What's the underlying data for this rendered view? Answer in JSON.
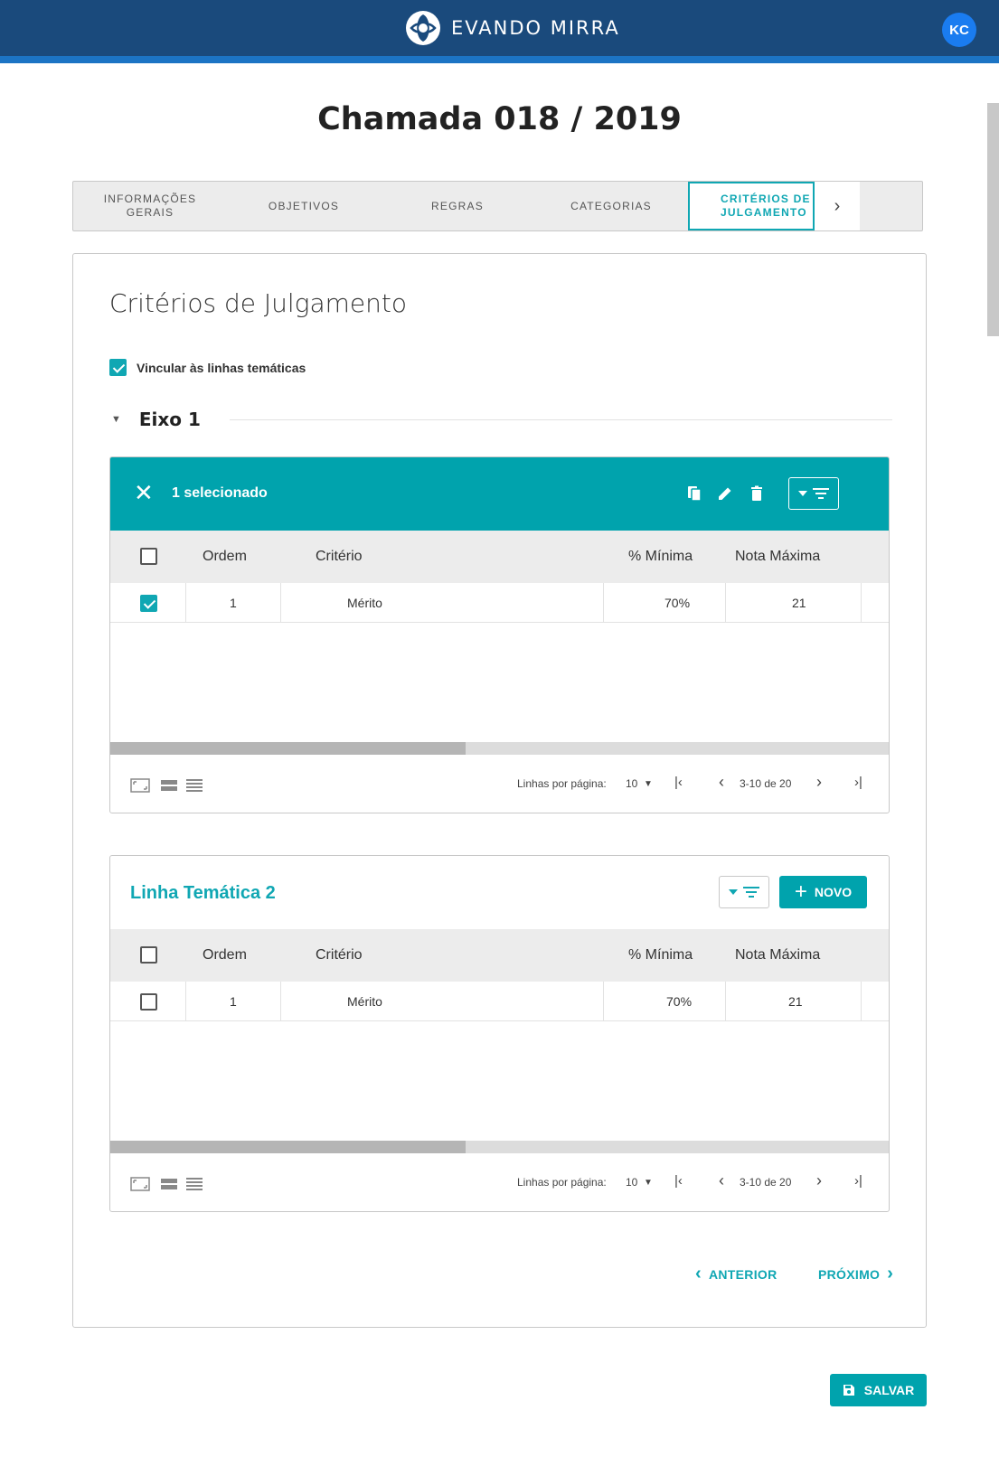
{
  "header": {
    "brand": "EVANDO MIRRA",
    "avatar_initials": "KC",
    "bar_color": "#1a4a7c",
    "accent": "#00a3ad"
  },
  "page_title": "Chamada 018 / 2019",
  "tabs": [
    {
      "label_l1": "INFORMAÇÕES",
      "label_l2": "GERAIS"
    },
    {
      "label_l1": "OBJETIVOS",
      "label_l2": ""
    },
    {
      "label_l1": "REGRAS",
      "label_l2": ""
    },
    {
      "label_l1": "CATEGORIAS",
      "label_l2": ""
    },
    {
      "label_l1": "CRITÉRIOS DE",
      "label_l2": "JULGAMENTO",
      "active": true
    }
  ],
  "section_title": "Critérios de Julgamento",
  "link_checkbox": {
    "label": "Vincular às linhas temáticas",
    "checked": true
  },
  "eixo": {
    "label": "Eixo 1"
  },
  "table1": {
    "selection_text": "1 selecionado",
    "columns": [
      "Ordem",
      "Critério",
      "% Mínima",
      "Nota Máxima"
    ],
    "rows": [
      {
        "checked": true,
        "ordem": "1",
        "criterio": "Mérito",
        "minima": "70%",
        "nota": "21"
      }
    ],
    "footer": {
      "rows_per_page_label": "Linhas por página:",
      "rows_per_page": "10",
      "range": "3-10 de 20"
    }
  },
  "table2": {
    "title": "Linha Temática 2",
    "new_label": "NOVO",
    "columns": [
      "Ordem",
      "Critério",
      "% Mínima",
      "Nota Máxima"
    ],
    "rows": [
      {
        "checked": false,
        "ordem": "1",
        "criterio": "Mérito",
        "minima": "70%",
        "nota": "21"
      }
    ],
    "footer": {
      "rows_per_page_label": "Linhas por página:",
      "rows_per_page": "10",
      "range": "3-10 de 20"
    }
  },
  "nav": {
    "prev": "ANTERIOR",
    "next": "PRÓXIMO"
  },
  "save_label": "SALVAR"
}
